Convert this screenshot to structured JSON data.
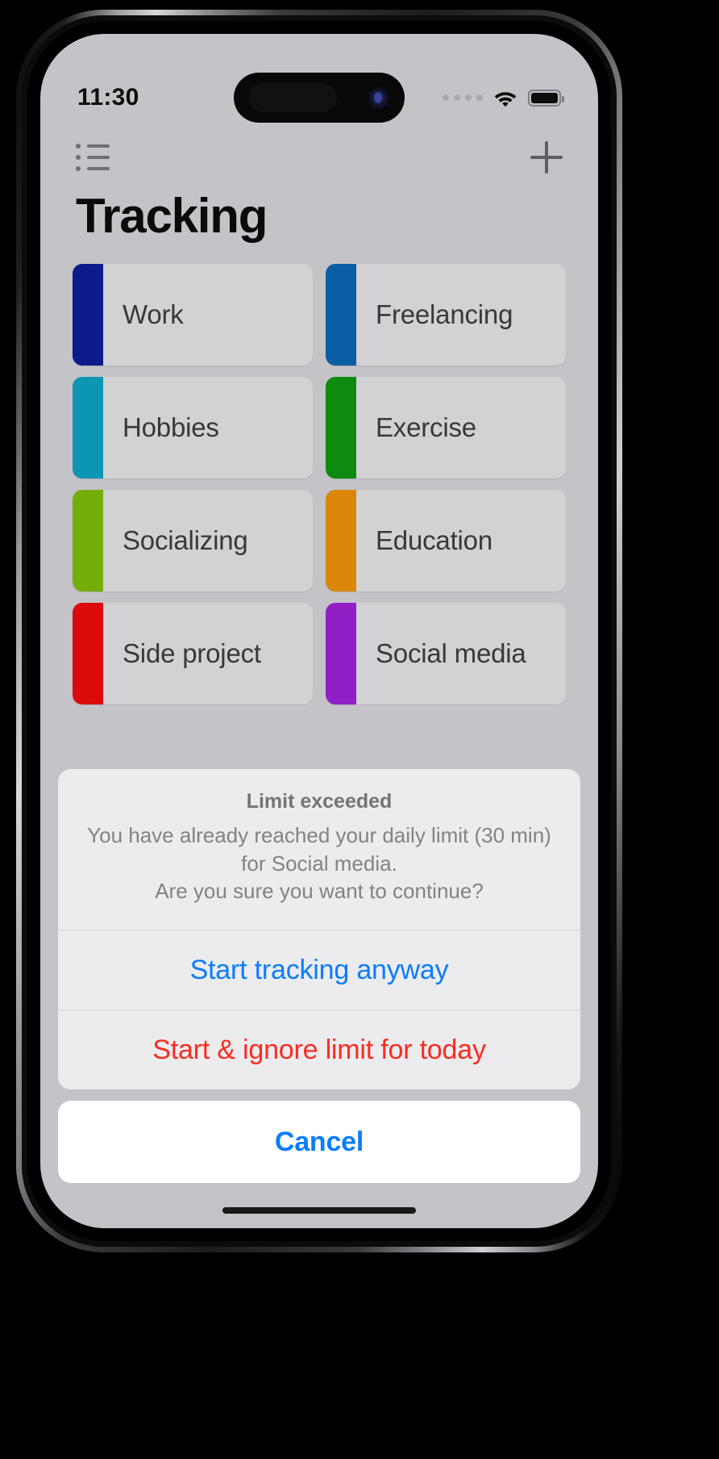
{
  "status_bar": {
    "time": "11:30",
    "cellular_icon": "cellular-dots-icon",
    "wifi_icon": "wifi-icon",
    "battery_icon": "battery-full-icon"
  },
  "nav": {
    "list_icon": "bulleted-list-icon",
    "add_icon": "plus-icon"
  },
  "header": {
    "title": "Tracking"
  },
  "categories": [
    {
      "label": "Work",
      "color": "#0d1a8c"
    },
    {
      "label": "Freelancing",
      "color": "#0a5ea4"
    },
    {
      "label": "Hobbies",
      "color": "#0d96b4"
    },
    {
      "label": "Exercise",
      "color": "#0f8a10"
    },
    {
      "label": "Socializing",
      "color": "#74ad09"
    },
    {
      "label": "Education",
      "color": "#da8709"
    },
    {
      "label": "Side project",
      "color": "#dc0b0b"
    },
    {
      "label": "Social media",
      "color": "#9020c6"
    }
  ],
  "action_sheet": {
    "title": "Limit exceeded",
    "message": "You have already reached your daily limit (30 min) for Social media.\nAre you sure you want to continue?",
    "buttons": [
      {
        "label": "Start tracking anyway",
        "color": "#0a7cff",
        "weight": "400"
      },
      {
        "label": "Start & ignore limit for today",
        "color": "#fb2c20",
        "weight": "400"
      }
    ],
    "cancel": {
      "label": "Cancel",
      "color": "#0a7cff"
    }
  }
}
